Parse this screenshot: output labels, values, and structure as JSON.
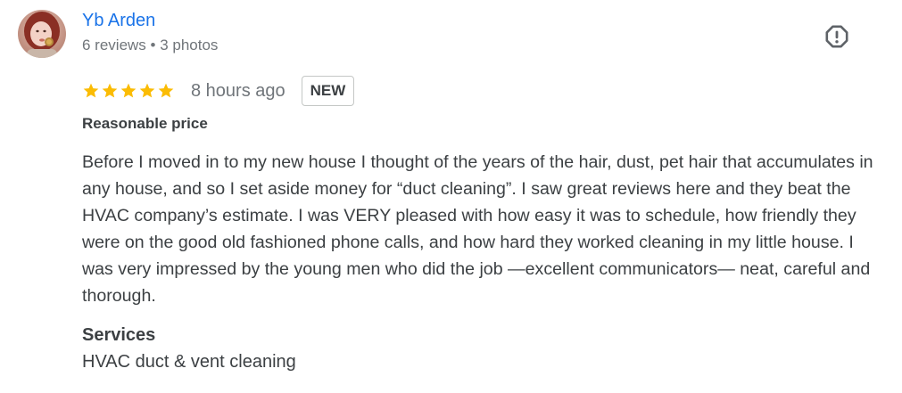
{
  "reviewer": {
    "name": "Yb Arden",
    "meta": "6 reviews • 3 photos"
  },
  "report": {
    "icon": "report-icon"
  },
  "review": {
    "rating": 5,
    "rating_max": 5,
    "time": "8 hours ago",
    "badge": "NEW",
    "attribute": "Reasonable price",
    "text": "Before I moved in to my new house I thought of the years of the hair, dust, pet hair that accumulates in any house, and so I set aside money for “duct cleaning”. I saw great reviews here and they beat the HVAC company’s estimate. I was VERY pleased with how easy it was to schedule, how friendly they were on the good old fashioned phone calls, and how hard they worked cleaning in my little house. I was very impressed by the young men who did the job —excellent communicators— neat, careful and thorough.",
    "services_label": "Services",
    "services_value": "HVAC duct & vent cleaning"
  },
  "colors": {
    "name_link": "#1a73e8",
    "star": "#fbbc04",
    "secondary_text": "#70757a",
    "body_text": "#3c4043"
  }
}
